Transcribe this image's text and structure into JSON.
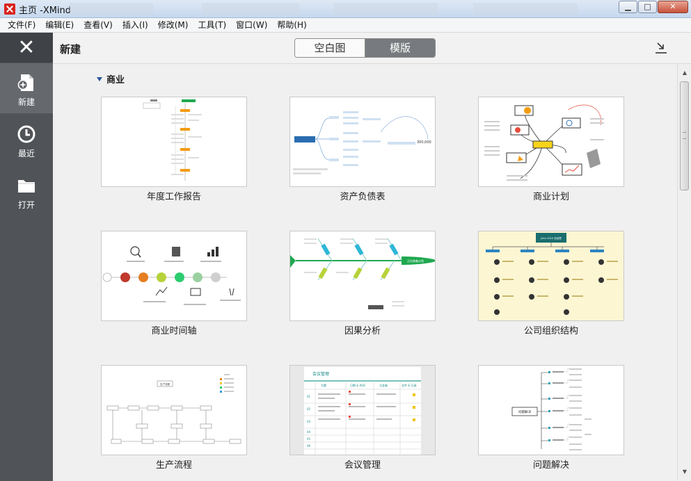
{
  "window": {
    "title": "主页 -XMind",
    "controls": {
      "minimize": "▁",
      "maximize": "□",
      "close": "✕"
    }
  },
  "menu": [
    "文件(F)",
    "编辑(E)",
    "查看(V)",
    "插入(I)",
    "修改(M)",
    "工具(T)",
    "窗口(W)",
    "帮助(H)"
  ],
  "sidebar": {
    "items": [
      {
        "label": "新建",
        "icon": "new-file-icon",
        "active": true
      },
      {
        "label": "最近",
        "icon": "clock-icon",
        "active": false
      },
      {
        "label": "打开",
        "icon": "folder-icon",
        "active": false
      }
    ]
  },
  "header": {
    "title": "新建",
    "segments": [
      "空白图",
      "模版"
    ],
    "selected_segment": "模版"
  },
  "section": {
    "title": "商业"
  },
  "templates": [
    {
      "label": "年度工作报告",
      "thumb": "report"
    },
    {
      "label": "资产负债表",
      "thumb": "balance"
    },
    {
      "label": "商业计划",
      "thumb": "plan"
    },
    {
      "label": "商业时间轴",
      "thumb": "timeline"
    },
    {
      "label": "因果分析",
      "thumb": "fishbone"
    },
    {
      "label": "公司组织结构",
      "thumb": "org"
    },
    {
      "label": "生产流程",
      "thumb": "flow"
    },
    {
      "label": "会议管理",
      "thumb": "meeting"
    },
    {
      "label": "问题解决",
      "thumb": "problem"
    }
  ],
  "thumb_text": {
    "balance_value": "300,000",
    "org_head": "John 2020 总经理",
    "flow_start": "生产流程",
    "meeting_title": "会议管理",
    "meeting_headers": [
      "主题",
      "日期 & 时间",
      "与会者",
      "文件 & 记录"
    ],
    "meeting_rows": [
      "01",
      "02",
      "03",
      "04",
      "05",
      "06"
    ],
    "problem_root": "问题解决",
    "fishbone_head": "正在做着计划"
  },
  "colors": {
    "sidebar": "#505357",
    "accent_orange": "#f39c12",
    "accent_green": "#1fa84f",
    "accent_blue": "#2b6cb0"
  }
}
